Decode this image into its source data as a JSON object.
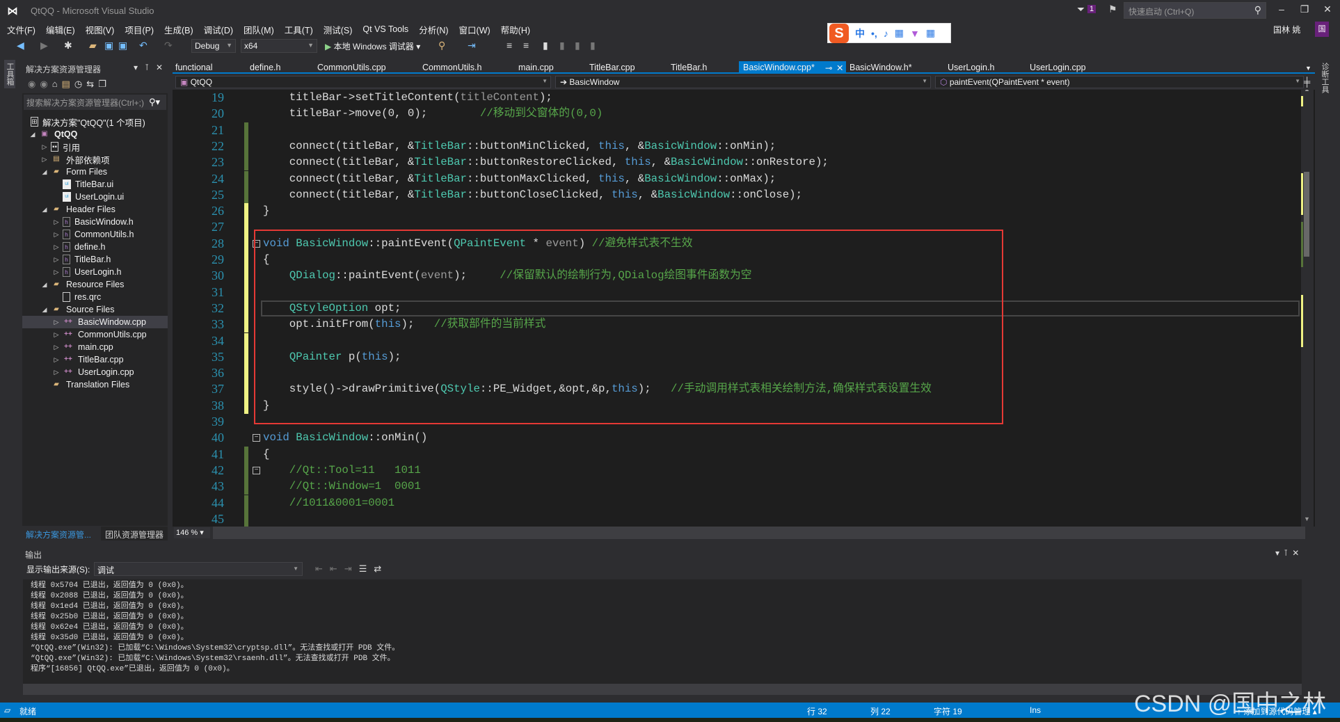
{
  "window": {
    "title": "QtQQ - Microsoft Visual Studio",
    "notification_count": "1",
    "quick_launch_placeholder": "快速启动 (Ctrl+Q)",
    "user": "国林 姚",
    "avatar_letter": "国"
  },
  "menu": [
    "文件(F)",
    "编辑(E)",
    "视图(V)",
    "项目(P)",
    "生成(B)",
    "调试(D)",
    "团队(M)",
    "工具(T)",
    "测试(S)",
    "Qt VS Tools",
    "分析(N)",
    "窗口(W)",
    "帮助(H)"
  ],
  "ime": {
    "logo": "S",
    "items": [
      "中",
      "•,",
      "🎤",
      "▦",
      "👕",
      "▦"
    ]
  },
  "toolbar": {
    "configuration": "Debug",
    "platform": "x64",
    "run_label": "本地 Windows 调试器"
  },
  "side_strips": {
    "left": "工具箱",
    "right": "诊断工具"
  },
  "explorer": {
    "title": "解决方案资源管理器",
    "search_placeholder": "搜索解决方案资源管理器(Ctrl+;)",
    "tree": [
      {
        "label": "解决方案\"QtQQ\"(1 个项目)",
        "depth": 0,
        "expander": "",
        "icon": "solution"
      },
      {
        "label": "QtQQ",
        "depth": 0,
        "expander": "open",
        "icon": "project"
      },
      {
        "label": "引用",
        "depth": 1,
        "expander": "closed",
        "icon": "references"
      },
      {
        "label": "外部依赖项",
        "depth": 1,
        "expander": "closed",
        "icon": "external-deps"
      },
      {
        "label": "Form Files",
        "depth": 1,
        "expander": "open",
        "icon": "folder"
      },
      {
        "label": "TitleBar.ui",
        "depth": 2,
        "expander": "",
        "icon": "ui"
      },
      {
        "label": "UserLogin.ui",
        "depth": 2,
        "expander": "",
        "icon": "ui"
      },
      {
        "label": "Header Files",
        "depth": 1,
        "expander": "open",
        "icon": "folder"
      },
      {
        "label": "BasicWindow.h",
        "depth": 2,
        "expander": "closed",
        "icon": "h"
      },
      {
        "label": "CommonUtils.h",
        "depth": 2,
        "expander": "closed",
        "icon": "h"
      },
      {
        "label": "define.h",
        "depth": 2,
        "expander": "closed",
        "icon": "h"
      },
      {
        "label": "TitleBar.h",
        "depth": 2,
        "expander": "closed",
        "icon": "h"
      },
      {
        "label": "UserLogin.h",
        "depth": 2,
        "expander": "closed",
        "icon": "h"
      },
      {
        "label": "Resource Files",
        "depth": 1,
        "expander": "open",
        "icon": "folder"
      },
      {
        "label": "res.qrc",
        "depth": 2,
        "expander": "",
        "icon": "file"
      },
      {
        "label": "Source Files",
        "depth": 1,
        "expander": "open",
        "icon": "folder"
      },
      {
        "label": "BasicWindow.cpp",
        "depth": 2,
        "expander": "closed",
        "icon": "cpp",
        "selected": true
      },
      {
        "label": "CommonUtils.cpp",
        "depth": 2,
        "expander": "closed",
        "icon": "cpp"
      },
      {
        "label": "main.cpp",
        "depth": 2,
        "expander": "closed",
        "icon": "cpp"
      },
      {
        "label": "TitleBar.cpp",
        "depth": 2,
        "expander": "closed",
        "icon": "cpp"
      },
      {
        "label": "UserLogin.cpp",
        "depth": 2,
        "expander": "closed",
        "icon": "cpp"
      },
      {
        "label": "Translation Files",
        "depth": 1,
        "expander": "",
        "icon": "folder"
      }
    ],
    "bottom_tabs": [
      "解决方案资源管...",
      "团队资源管理器"
    ]
  },
  "editor": {
    "tabs": [
      "functional",
      "define.h",
      "CommonUtils.cpp",
      "CommonUtils.h",
      "main.cpp",
      "TitleBar.cpp",
      "TitleBar.h",
      "BasicWindow.cpp*",
      "BasicWindow.h*",
      "UserLogin.h",
      "UserLogin.cpp"
    ],
    "active_tab": "BasicWindow.cpp*",
    "nav": {
      "project": "QtQQ",
      "class": "BasicWindow",
      "member": "paintEvent(QPaintEvent * event)"
    },
    "zoom": "146 %",
    "current_line": 32,
    "highlight_box_lines": [
      28,
      39
    ],
    "lines": [
      {
        "n": 19,
        "chg": "",
        "t": [
          [
            "tx",
            "    titleBar->setTitleContent("
          ],
          [
            "pa",
            "titleContent"
          ],
          [
            "tx",
            ");"
          ]
        ]
      },
      {
        "n": 20,
        "chg": "",
        "t": [
          [
            "tx",
            "    titleBar->move(0, 0);        "
          ],
          [
            "cm",
            "//移动到父窗体的(0,0)"
          ]
        ]
      },
      {
        "n": 21,
        "chg": "saved",
        "t": []
      },
      {
        "n": 22,
        "chg": "saved",
        "t": [
          [
            "tx",
            "    connect(titleBar, &"
          ],
          [
            "ty",
            "TitleBar"
          ],
          [
            "tx",
            "::buttonMinClicked, "
          ],
          [
            "kw",
            "this"
          ],
          [
            "tx",
            ", &"
          ],
          [
            "ty",
            "BasicWindow"
          ],
          [
            "tx",
            "::onMin);"
          ]
        ]
      },
      {
        "n": 23,
        "chg": "saved",
        "t": [
          [
            "tx",
            "    connect(titleBar, &"
          ],
          [
            "ty",
            "TitleBar"
          ],
          [
            "tx",
            "::buttonRestoreClicked, "
          ],
          [
            "kw",
            "this"
          ],
          [
            "tx",
            ", &"
          ],
          [
            "ty",
            "BasicWindow"
          ],
          [
            "tx",
            "::onRestore);"
          ]
        ]
      },
      {
        "n": 24,
        "chg": "saved",
        "t": [
          [
            "tx",
            "    connect(titleBar, &"
          ],
          [
            "ty",
            "TitleBar"
          ],
          [
            "tx",
            "::buttonMaxClicked, "
          ],
          [
            "kw",
            "this"
          ],
          [
            "tx",
            ", &"
          ],
          [
            "ty",
            "BasicWindow"
          ],
          [
            "tx",
            "::onMax);"
          ]
        ]
      },
      {
        "n": 25,
        "chg": "saved",
        "t": [
          [
            "tx",
            "    connect(titleBar, &"
          ],
          [
            "ty",
            "TitleBar"
          ],
          [
            "tx",
            "::buttonCloseClicked, "
          ],
          [
            "kw",
            "this"
          ],
          [
            "tx",
            ", &"
          ],
          [
            "ty",
            "BasicWindow"
          ],
          [
            "tx",
            "::onClose);"
          ]
        ]
      },
      {
        "n": 26,
        "chg": "unsaved",
        "t": [
          [
            "tx",
            "}"
          ]
        ]
      },
      {
        "n": 27,
        "chg": "unsaved",
        "t": []
      },
      {
        "n": 28,
        "chg": "unsaved",
        "fold": true,
        "t": [
          [
            "kw",
            "void"
          ],
          [
            "tx",
            " "
          ],
          [
            "ty",
            "BasicWindow"
          ],
          [
            "tx",
            "::paintEvent("
          ],
          [
            "ty",
            "QPaintEvent"
          ],
          [
            "tx",
            " * "
          ],
          [
            "pa",
            "event"
          ],
          [
            "tx",
            ") "
          ],
          [
            "cm",
            "//避免样式表不生效"
          ]
        ]
      },
      {
        "n": 29,
        "chg": "unsaved",
        "t": [
          [
            "tx",
            "{"
          ]
        ]
      },
      {
        "n": 30,
        "chg": "unsaved",
        "t": [
          [
            "tx",
            "    "
          ],
          [
            "ty",
            "QDialog"
          ],
          [
            "tx",
            "::paintEvent("
          ],
          [
            "pa",
            "event"
          ],
          [
            "tx",
            ");     "
          ],
          [
            "cm",
            "//保留默认的绘制行为,QDialog绘图事件函数为空"
          ]
        ]
      },
      {
        "n": 31,
        "chg": "unsaved",
        "t": []
      },
      {
        "n": 32,
        "chg": "unsaved",
        "t": [
          [
            "tx",
            "    "
          ],
          [
            "ty",
            "QStyleOption"
          ],
          [
            "tx",
            " opt;"
          ]
        ]
      },
      {
        "n": 33,
        "chg": "unsaved",
        "t": [
          [
            "tx",
            "    opt.initFrom("
          ],
          [
            "kw",
            "this"
          ],
          [
            "tx",
            ");   "
          ],
          [
            "cm",
            "//获取部件的当前样式"
          ]
        ]
      },
      {
        "n": 34,
        "chg": "unsaved",
        "t": []
      },
      {
        "n": 35,
        "chg": "unsaved",
        "t": [
          [
            "tx",
            "    "
          ],
          [
            "ty",
            "QPainter"
          ],
          [
            "tx",
            " p("
          ],
          [
            "kw",
            "this"
          ],
          [
            "tx",
            ");"
          ]
        ]
      },
      {
        "n": 36,
        "chg": "unsaved",
        "t": []
      },
      {
        "n": 37,
        "chg": "unsaved",
        "t": [
          [
            "tx",
            "    style()->drawPrimitive("
          ],
          [
            "ty",
            "QStyle"
          ],
          [
            "tx",
            "::PE_Widget,&opt,&p,"
          ],
          [
            "kw",
            "this"
          ],
          [
            "tx",
            ");   "
          ],
          [
            "cm",
            "//手动调用样式表相关绘制方法,确保样式表设置生效"
          ]
        ]
      },
      {
        "n": 38,
        "chg": "unsaved",
        "t": [
          [
            "tx",
            "}"
          ]
        ]
      },
      {
        "n": 39,
        "chg": "",
        "t": []
      },
      {
        "n": 40,
        "chg": "",
        "fold": true,
        "t": [
          [
            "kw",
            "void"
          ],
          [
            "tx",
            " "
          ],
          [
            "ty",
            "BasicWindow"
          ],
          [
            "tx",
            "::onMin()"
          ]
        ]
      },
      {
        "n": 41,
        "chg": "saved",
        "t": [
          [
            "tx",
            "{"
          ]
        ]
      },
      {
        "n": 42,
        "chg": "saved",
        "fold": true,
        "t": [
          [
            "cm",
            "    //Qt::Tool=11   1011"
          ]
        ]
      },
      {
        "n": 43,
        "chg": "saved",
        "t": [
          [
            "cm",
            "    //Qt::Window=1  0001"
          ]
        ]
      },
      {
        "n": 44,
        "chg": "saved",
        "t": [
          [
            "cm",
            "    //1011&0001=0001"
          ]
        ]
      },
      {
        "n": 45,
        "chg": "saved",
        "t": []
      }
    ]
  },
  "output": {
    "title": "输出",
    "source_label": "显示输出来源(S):",
    "source_value": "调试",
    "lines": [
      "线程 0x5704 已退出，返回值为 0 (0x0)。",
      "线程 0x2088 已退出，返回值为 0 (0x0)。",
      "线程 0x1ed4 已退出，返回值为 0 (0x0)。",
      "线程 0x25b0 已退出，返回值为 0 (0x0)。",
      "线程 0x62e4 已退出，返回值为 0 (0x0)。",
      "线程 0x35d0 已退出，返回值为 0 (0x0)。",
      "“QtQQ.exe”(Win32): 已加载“C:\\Windows\\System32\\cryptsp.dll”。无法查找或打开 PDB 文件。",
      "“QtQQ.exe”(Win32): 已加载“C:\\Windows\\System32\\rsaenh.dll”。无法查找或打开 PDB 文件。",
      "程序“[16856] QtQQ.exe”已退出，返回值为 0 (0x0)。"
    ]
  },
  "status": {
    "state": "就绪",
    "line": "行 32",
    "col": "列 22",
    "char": "字符 19",
    "mode": "Ins",
    "source_control": "添加到源代码管理"
  },
  "watermark": "CSDN @国中之林",
  "colors": {
    "accent": "#007acc",
    "highlight_box": "#e53935",
    "saved_change": "#57743a",
    "unsaved_change": "#eff284"
  }
}
